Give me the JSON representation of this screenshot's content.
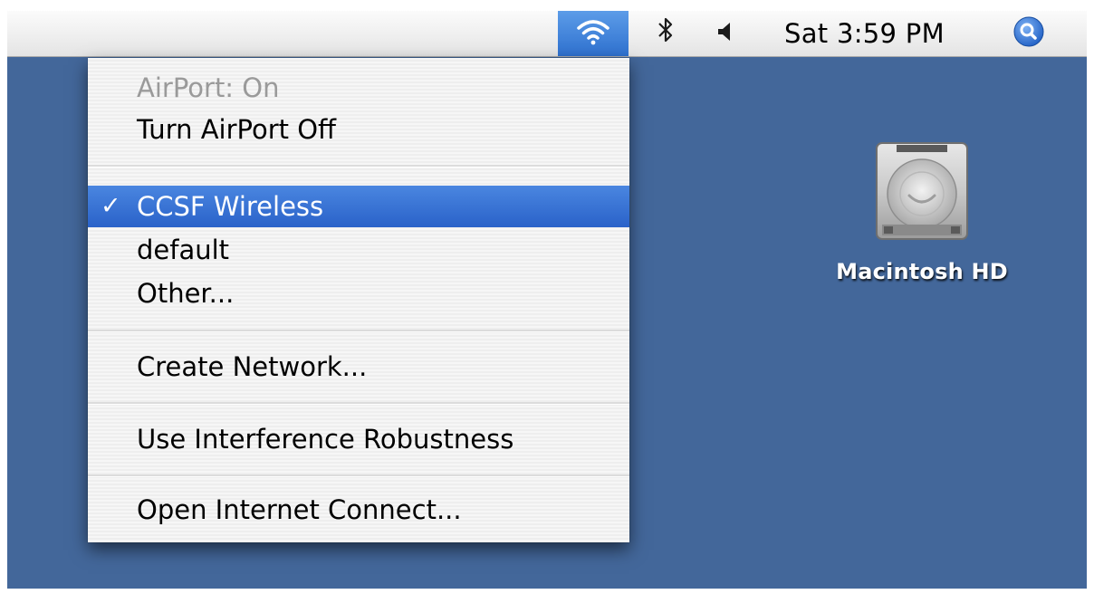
{
  "menubar": {
    "status_items": [
      {
        "name": "airport",
        "icon": "wifi-icon",
        "active": true
      },
      {
        "name": "bluetooth",
        "icon": "bluetooth-icon"
      },
      {
        "name": "volume",
        "icon": "speaker-icon"
      },
      {
        "name": "spotlight",
        "icon": "magnifier-icon"
      }
    ],
    "clock": "Sat 3:59 PM"
  },
  "airport_menu": {
    "status_label": "AirPort: On",
    "toggle_label": "Turn AirPort Off",
    "networks": [
      {
        "label": "CCSF Wireless",
        "checked": true,
        "check_mark": "✓"
      },
      {
        "label": "default",
        "checked": false
      },
      {
        "label": "Other...",
        "checked": false
      }
    ],
    "create_network_label": "Create Network...",
    "interference_label": "Use Interference Robustness",
    "open_internet_connect_label": "Open Internet Connect..."
  },
  "desktop": {
    "icons": [
      {
        "label": "Macintosh HD",
        "icon": "hard-drive-icon"
      }
    ]
  },
  "colors": {
    "desktop_background": "#43679a",
    "selection_highlight": "#2f6ad2",
    "menu_background": "#f4f4f4",
    "disabled_text": "#9a9a9a"
  }
}
